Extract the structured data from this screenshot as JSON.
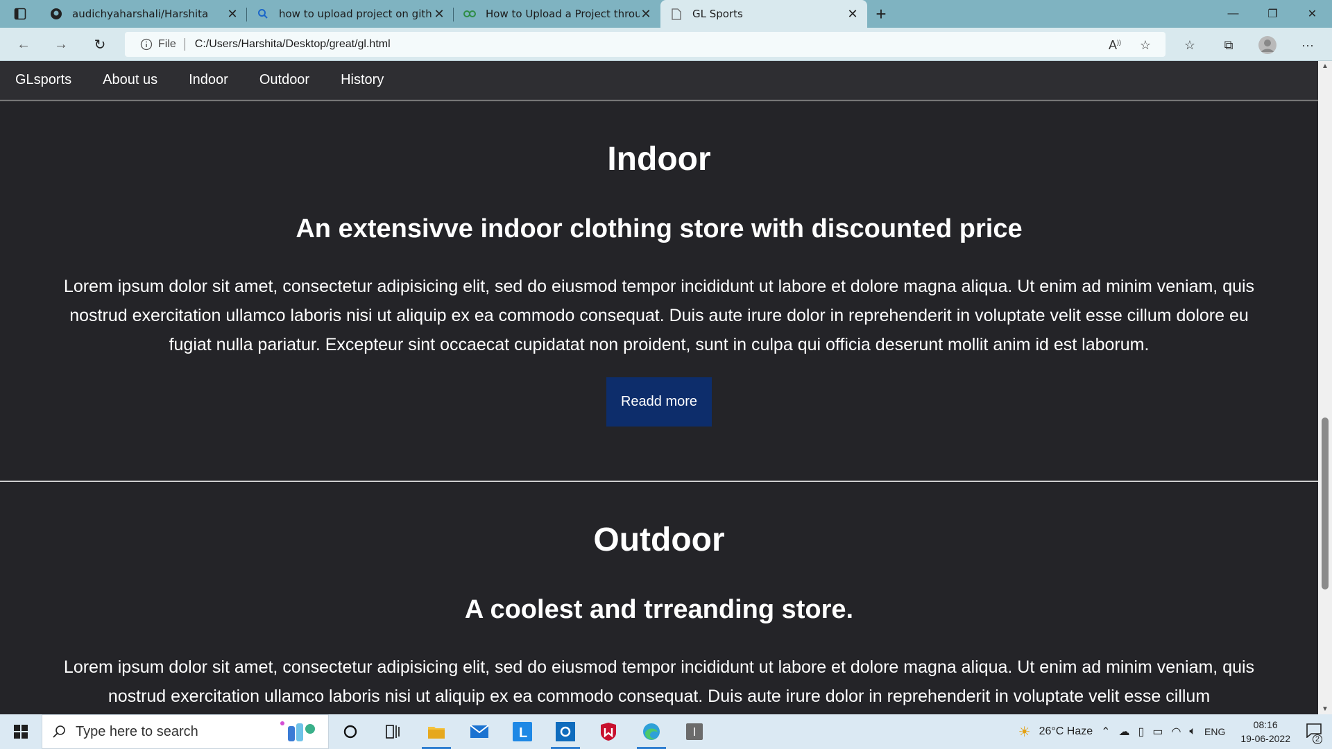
{
  "browser": {
    "tabs": [
      {
        "label": "audichyaharshali/Harshita",
        "icon": "github-icon",
        "active": false
      },
      {
        "label": "how to upload project on github",
        "icon": "search-icon",
        "active": false
      },
      {
        "label": "How to Upload a Project through",
        "icon": "gfg-icon",
        "active": false
      },
      {
        "label": "GL Sports",
        "icon": "page-icon",
        "active": true
      }
    ],
    "address": {
      "scheme_label": "File",
      "url": "C:/Users/Harshita/Desktop/great/gl.html"
    }
  },
  "site": {
    "nav": [
      "GLsports",
      "About us",
      "Indoor",
      "Outdoor",
      "History"
    ],
    "indoor": {
      "title": "Indoor",
      "subtitle": "An extensivve indoor clothing store with discounted price",
      "body": "Lorem ipsum dolor sit amet, consectetur adipisicing elit, sed do eiusmod tempor incididunt ut labore et dolore magna aliqua. Ut enim ad minim veniam, quis nostrud exercitation ullamco laboris nisi ut aliquip ex ea commodo consequat. Duis aute irure dolor in reprehenderit in voluptate velit esse cillum dolore eu fugiat nulla pariatur. Excepteur sint occaecat cupidatat non proident, sunt in culpa qui officia deserunt mollit anim id est laborum.",
      "button": "Readd more"
    },
    "outdoor": {
      "title": "Outdoor",
      "subtitle": "A coolest and trreanding store.",
      "body": "Lorem ipsum dolor sit amet, consectetur adipisicing elit, sed do eiusmod tempor incididunt ut labore et dolore magna aliqua. Ut enim ad minim veniam, quis nostrud exercitation ullamco laboris nisi ut aliquip ex ea commodo consequat. Duis aute irure dolor in reprehenderit in voluptate velit esse cillum"
    }
  },
  "taskbar": {
    "search_placeholder": "Type here to search",
    "weather": "26°C  Haze",
    "language": "ENG",
    "time": "08:16",
    "date": "19-06-2022",
    "notifications": "2"
  }
}
